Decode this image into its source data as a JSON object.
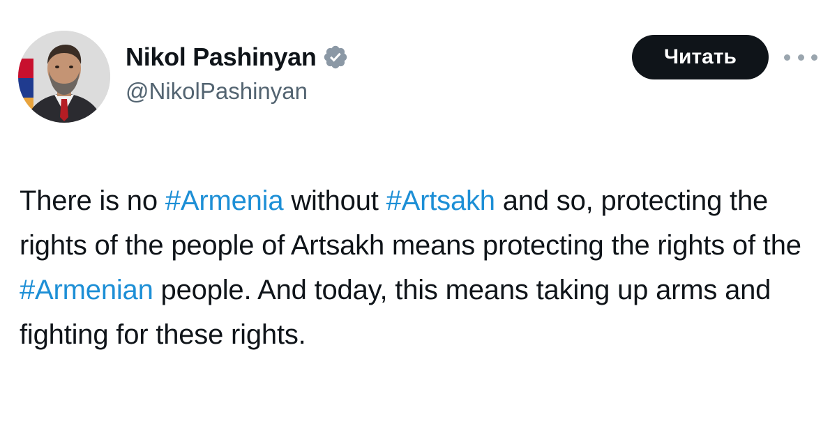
{
  "author": {
    "display_name": "Nikol Pashinyan",
    "handle": "@NikolPashinyan",
    "verified_icon": "verified-badge-icon",
    "avatar_icon": "profile-photo-icon"
  },
  "actions": {
    "follow_label": "Читать",
    "more_icon": "more-options-icon"
  },
  "tweet": {
    "segments": [
      {
        "text": "There is no ",
        "type": "text"
      },
      {
        "text": "#Armenia",
        "type": "hashtag"
      },
      {
        "text": " without ",
        "type": "text"
      },
      {
        "text": "#Artsakh",
        "type": "hashtag"
      },
      {
        "text": " and so, protecting the rights of the people of Artsakh means protecting the rights of the ",
        "type": "text"
      },
      {
        "text": "#Armenian",
        "type": "hashtag"
      },
      {
        "text": " people. And today, this means taking up arms and fighting for these rights.",
        "type": "text"
      }
    ]
  },
  "colors": {
    "text": "#0f1419",
    "secondary_text": "#536471",
    "hashtag": "#1d8fd6",
    "verified_badge": "#8b98a5",
    "button_bg": "#0f1419",
    "button_text": "#ffffff"
  }
}
